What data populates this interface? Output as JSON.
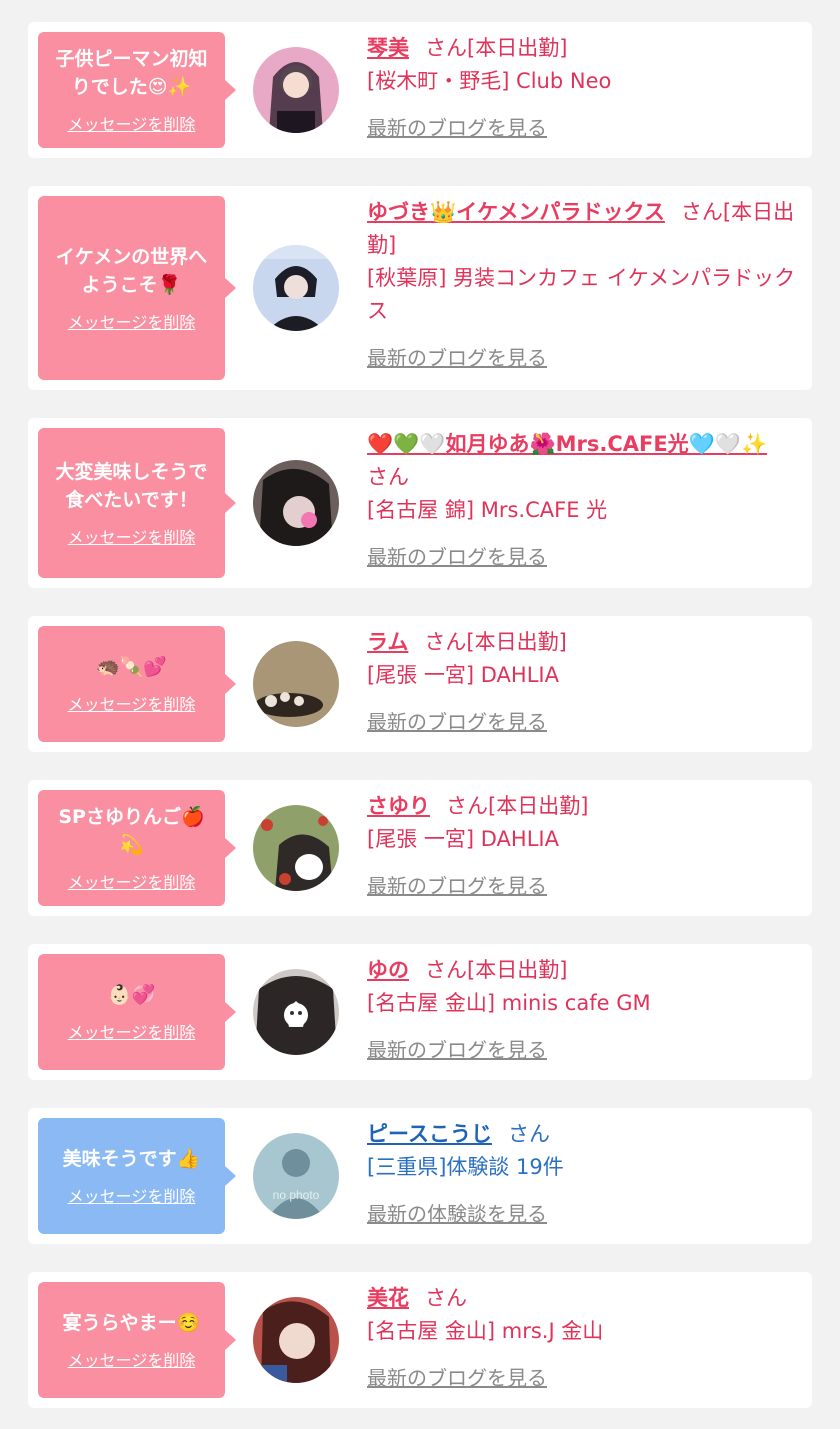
{
  "delete_label": "メッセージを削除",
  "items": [
    {
      "message": "子供ピーマン初知\nりでした😍✨",
      "name": "琴美",
      "suffix": "さん[本日出勤]",
      "shop": "[桜木町・野毛] Club Neo",
      "link": "最新のブログを見る",
      "avatar_colors": [
        "#e8a9c6",
        "#3b2a3a"
      ]
    },
    {
      "message": "イケメンの世界へ\nようこそ🌹",
      "name": "ゆづき👑イケメンパラドックス",
      "suffix": "さん[本日出勤]",
      "shop": "[秋葉原] 男装コンカフェ イケメンパラドックス",
      "link": "最新のブログを見る",
      "avatar_colors": [
        "#c9d7ee",
        "#1d1d2a"
      ]
    },
    {
      "message": "大変美味しそうで\n食べたいです！",
      "name": "❤️💚🤍如月ゆあ🌺Mrs.CAFE光🩵🤍✨",
      "suffix": "さん",
      "shop": "[名古屋 錦] Mrs.CAFE 光",
      "link": "最新のブログを見る",
      "avatar_colors": [
        "#6b5f5c",
        "#1f1a1a"
      ]
    },
    {
      "message": "🦔🍡💕",
      "name": "ラム",
      "suffix": "さん[本日出勤]",
      "shop": "[尾張 一宮] DAHLIA",
      "link": "最新のブログを見る",
      "avatar_colors": [
        "#a99676",
        "#3a3026"
      ]
    },
    {
      "message": "SPさゆりんご🍎\n💫",
      "name": "さゆり",
      "suffix": "さん[本日出勤]",
      "shop": "[尾張 一宮] DAHLIA",
      "link": "最新のブログを見る",
      "avatar_colors": [
        "#8fa06a",
        "#2f2a28"
      ]
    },
    {
      "message": "👶🏻💞",
      "name": "ゆの",
      "suffix": "さん[本日出勤]",
      "shop": "[名古屋 金山] minis cafe GM",
      "link": "最新のブログを見る",
      "avatar_colors": [
        "#cfc9c6",
        "#2c2626"
      ]
    },
    {
      "message": "美味そうです👍",
      "name": "ピースこうじ",
      "suffix": "さん",
      "shop": "[三重県]体験談 19件",
      "link": "最新の体験談を見る",
      "avatar_colors": [
        "#a7c6cf",
        "#6f8f9c"
      ],
      "avatar_caption": "no photo"
    },
    {
      "message": "宴うらやまー☺️",
      "name": "美花",
      "suffix": "さん",
      "shop": "[名古屋 金山] mrs.J 金山",
      "link": "最新のブログを見る",
      "avatar_colors": [
        "#b9524b",
        "#f0d9cf"
      ]
    }
  ]
}
